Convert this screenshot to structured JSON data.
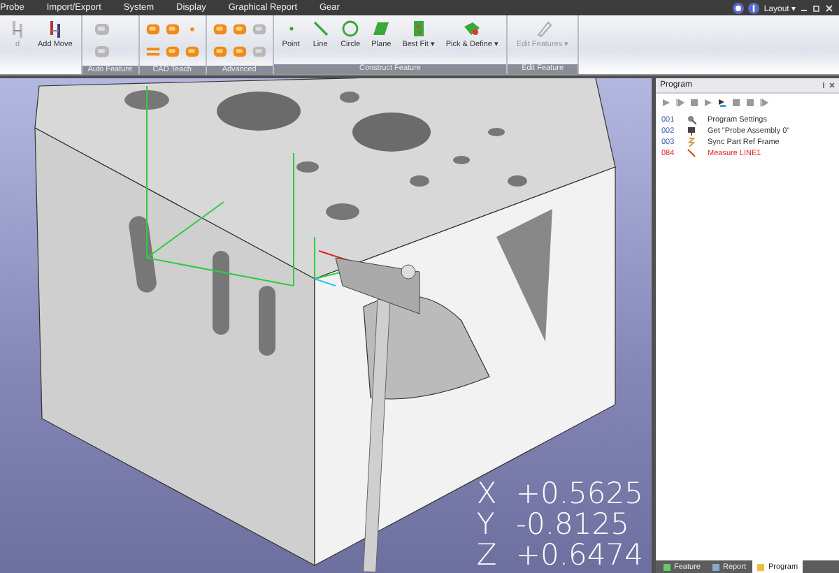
{
  "menu": [
    {
      "label": "Probe"
    },
    {
      "label": "Import/Export"
    },
    {
      "label": "System"
    },
    {
      "label": "Display"
    },
    {
      "label": "Graphical Report"
    },
    {
      "label": "Gear"
    }
  ],
  "window_controls": {
    "layout": "Layout ▾"
  },
  "ribbon": [
    {
      "buttons": [
        {
          "kind": "move",
          "label": "d",
          "disabled": true
        },
        {
          "kind": "move",
          "label": "Add Move",
          "disabled": false
        }
      ]
    },
    {
      "label": "Auto Feature",
      "buttons": [
        {
          "kind": "blob",
          "disabled": true
        },
        {
          "kind": "blob",
          "disabled": true
        }
      ]
    },
    {
      "label": "CAD Teach",
      "buttons": [
        {
          "kind": "blob",
          "disabled": false
        },
        {
          "kind": "blob",
          "disabled": false
        },
        {
          "kind": "dot",
          "disabled": false
        },
        {
          "kind": "equals",
          "disabled": false
        },
        {
          "kind": "blob",
          "disabled": false
        },
        {
          "kind": "blob",
          "disabled": false
        }
      ]
    },
    {
      "label": "Advanced",
      "buttons": [
        {
          "kind": "blob",
          "disabled": false
        },
        {
          "kind": "blob",
          "disabled": false
        },
        {
          "kind": "blob",
          "disabled": true
        },
        {
          "kind": "blob",
          "disabled": false
        },
        {
          "kind": "blob",
          "disabled": false
        },
        {
          "kind": "blob",
          "disabled": true
        }
      ]
    },
    {
      "label": "Construct Feature",
      "buttons": [
        {
          "kind": "point",
          "label": "Point",
          "disabled": false
        },
        {
          "kind": "line",
          "label": "Line",
          "disabled": false
        },
        {
          "kind": "circle",
          "label": "Circle",
          "disabled": false
        },
        {
          "kind": "plane",
          "label": "Plane",
          "disabled": false
        },
        {
          "kind": "fit",
          "label": "Best Fit ▾",
          "disabled": false
        },
        {
          "kind": "pick",
          "label": "Pick & Define ▾",
          "disabled": false
        }
      ]
    },
    {
      "label": "Edit Feature",
      "buttons": [
        {
          "kind": "pen",
          "label": "Edit Features ▾",
          "disabled": true
        }
      ]
    }
  ],
  "program_panel": {
    "title": "Program",
    "rows": [
      {
        "number": "001",
        "label": "Program Settings",
        "current": false
      },
      {
        "number": "002",
        "label": "Get \"Probe Assembly 0\"",
        "current": false
      },
      {
        "number": "003",
        "label": "Sync Part Ref Frame",
        "current": false
      },
      {
        "number": "084",
        "label": "Measure LINE1",
        "current": true
      }
    ],
    "tabs": [
      {
        "label": "Feature",
        "selected": false
      },
      {
        "label": "Report",
        "selected": false
      },
      {
        "label": "Program",
        "selected": true
      }
    ]
  },
  "readout": [
    {
      "axis": "X",
      "value": "+0.5625"
    },
    {
      "axis": "Y",
      "value": "-0.8125"
    },
    {
      "axis": "Z",
      "value": "+0.6474"
    }
  ]
}
